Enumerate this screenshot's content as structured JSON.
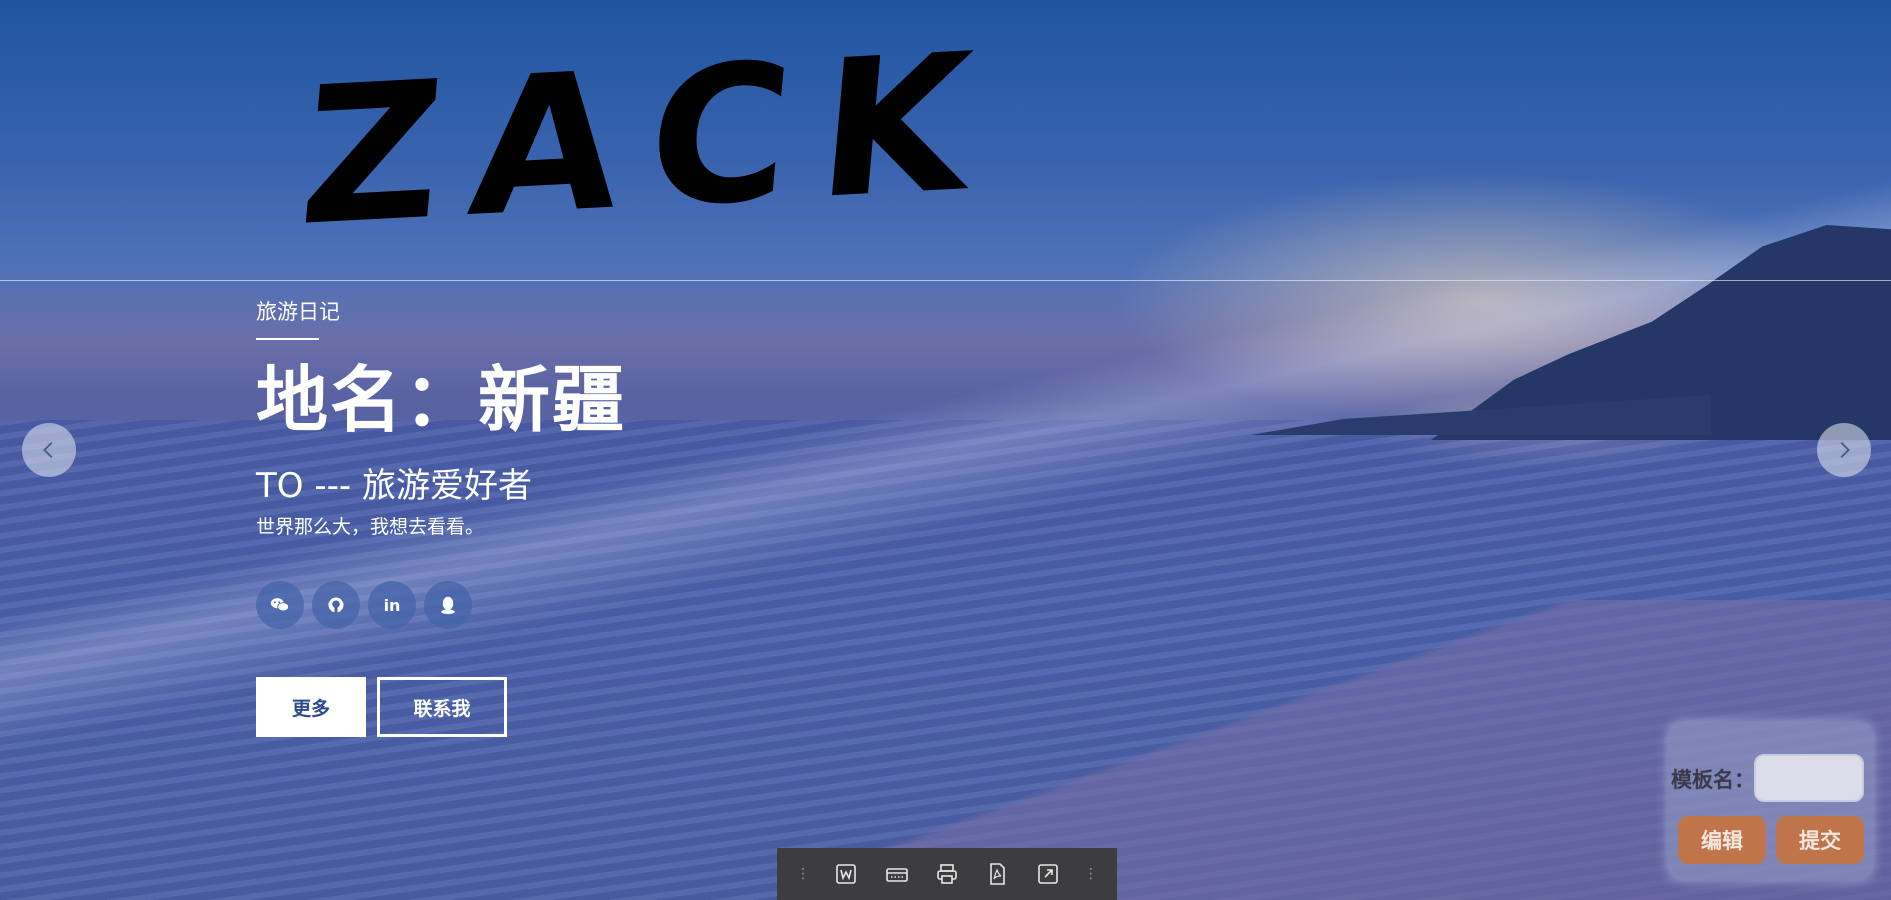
{
  "logo": {
    "text": "ZACK"
  },
  "hero": {
    "tag": "旅游日记",
    "title": "地名：新疆",
    "subtitle": "TO --- 旅游爱好者",
    "description": "世界那么大，我想去看看。",
    "socials": [
      {
        "name": "wechat",
        "icon": "wechat-icon"
      },
      {
        "name": "github",
        "icon": "github-icon"
      },
      {
        "name": "linkedin",
        "icon": "linkedin-icon",
        "glyph": "in"
      },
      {
        "name": "qq",
        "icon": "qq-icon"
      }
    ],
    "buttons": {
      "more": "更多",
      "contact": "联系我"
    }
  },
  "slider": {
    "prev": "chevron-left-icon",
    "next": "chevron-right-icon"
  },
  "template_panel": {
    "label": "模板名：",
    "input_value": "",
    "edit_label": "编辑",
    "submit_label": "提交"
  },
  "toolbar": {
    "tools": [
      "word-icon",
      "keyboard-icon",
      "print-icon",
      "pdf-icon",
      "expand-icon"
    ]
  }
}
